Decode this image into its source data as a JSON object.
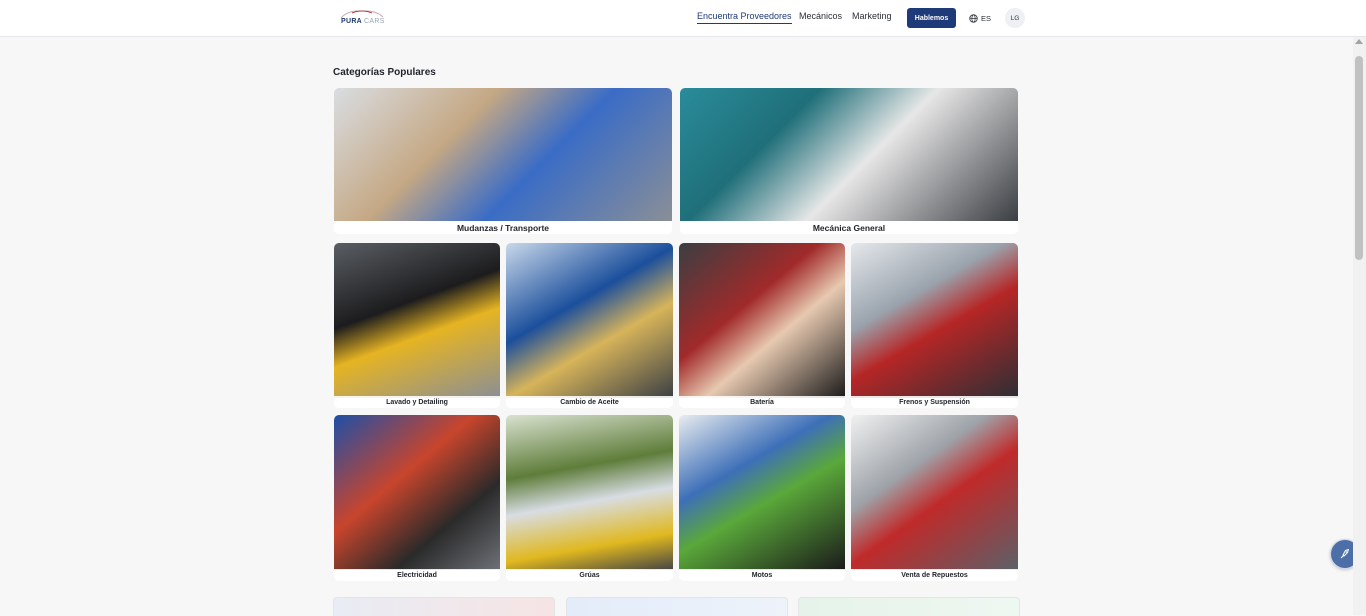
{
  "header": {
    "logo_text": "PURA",
    "logo_accent": "CARS",
    "nav": [
      {
        "label": "Encuentra Proveedores",
        "active": true
      },
      {
        "label": "Mecánicos",
        "active": false
      },
      {
        "label": "Marketing",
        "active": false
      }
    ],
    "cta_label": "Hablemos",
    "language": {
      "icon": "globe-icon",
      "label": "ES"
    },
    "user_initials": "LG"
  },
  "main": {
    "section_title": "Categorías Populares",
    "categories": [
      {
        "label": "Mudanzas / Transporte"
      },
      {
        "label": "Mecánica General"
      },
      {
        "label": "Lavado y Detailing"
      },
      {
        "label": "Cambio de Aceite"
      },
      {
        "label": "Batería"
      },
      {
        "label": "Frenos y Suspensión"
      },
      {
        "label": "Electricidad"
      },
      {
        "label": "Grúas"
      },
      {
        "label": "Motos"
      },
      {
        "label": "Venta de Repuestos"
      }
    ]
  },
  "widgets": {
    "chat_icon": "rocket-icon"
  },
  "colors": {
    "brand": "#1e3a78",
    "background": "#f7f7f8"
  }
}
